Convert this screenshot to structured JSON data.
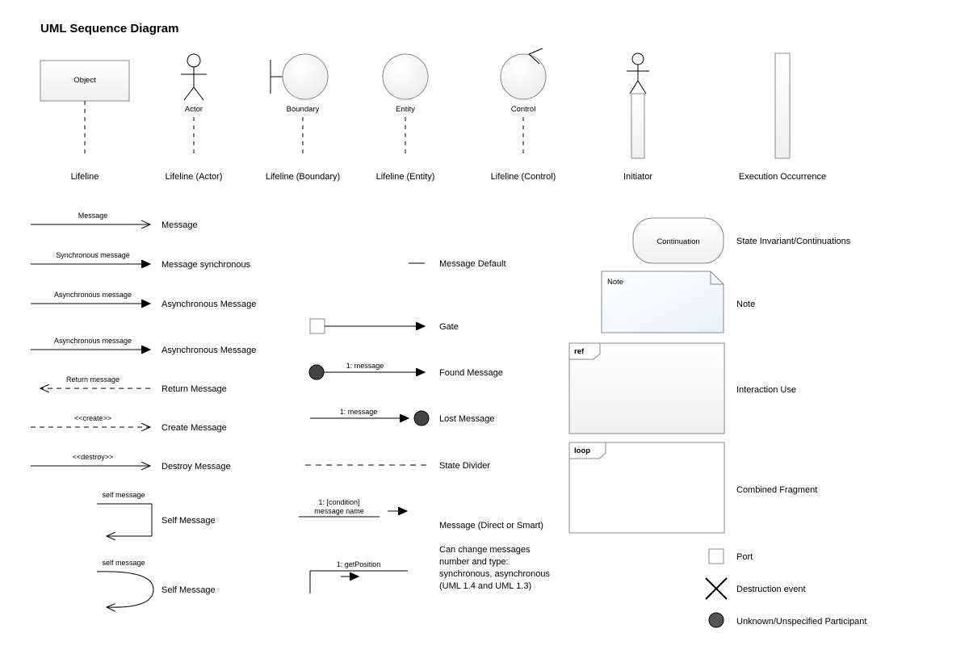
{
  "title": "UML Sequence Diagram",
  "lifelines": {
    "object_text": "Object",
    "object_caption": "Lifeline",
    "actor_label": "Actor",
    "actor_caption": "Lifeline (Actor)",
    "boundary_label": "Boundary",
    "boundary_caption": "Lifeline (Boundary)",
    "entity_label": "Entity",
    "entity_caption": "Lifeline (Entity)",
    "control_label": "Control",
    "control_caption": "Lifeline (Control)",
    "initiator_caption": "Initiator",
    "execution_caption": "Execution Occurrence"
  },
  "messages": {
    "msg": {
      "text": "Message",
      "caption": "Message"
    },
    "sync": {
      "text": "Synchronous message",
      "caption": "Message synchronous"
    },
    "async1": {
      "text": "Asynchronous message",
      "caption": "Asynchronous Message"
    },
    "async2": {
      "text": "Asynchronous message",
      "caption": "Asynchronous Message"
    },
    "return": {
      "text": "Return message",
      "caption": "Return Message"
    },
    "create": {
      "text": "<<create>>",
      "caption": "Create Message"
    },
    "destroy": {
      "text": "<<destroy>>",
      "caption": "Destroy Message"
    },
    "self1": {
      "text": "self message",
      "caption": "Self Message"
    },
    "self2": {
      "text": "self message",
      "caption": "Self Message"
    }
  },
  "middle": {
    "default": "Message Default",
    "gate": "Gate",
    "found": {
      "text": "1: message",
      "caption": "Found Message"
    },
    "lost": {
      "text": "1: message",
      "caption": "Lost Message"
    },
    "divider": "State Divider",
    "direct": {
      "line1": "1: [condition]",
      "line2": "message name",
      "caption": "Message (Direct or Smart)"
    },
    "smart": {
      "text": "1: getPosition",
      "caption1": "Can change messages",
      "caption2": "number and type:",
      "caption3": "synchronous, asynchronous",
      "caption4": "(UML 1.4 and UML 1.3)"
    }
  },
  "right": {
    "continuation": {
      "text": "Continuation",
      "caption": "State Invariant/Continuations"
    },
    "note": {
      "text": "Note",
      "caption": "Note"
    },
    "interaction": {
      "text": "ref",
      "caption": "Interaction Use"
    },
    "combined": {
      "text": "loop",
      "caption": "Combined Fragment"
    },
    "port": "Port",
    "destruction": "Destruction event",
    "unknown": "Unknown/Unspecified Participant"
  }
}
